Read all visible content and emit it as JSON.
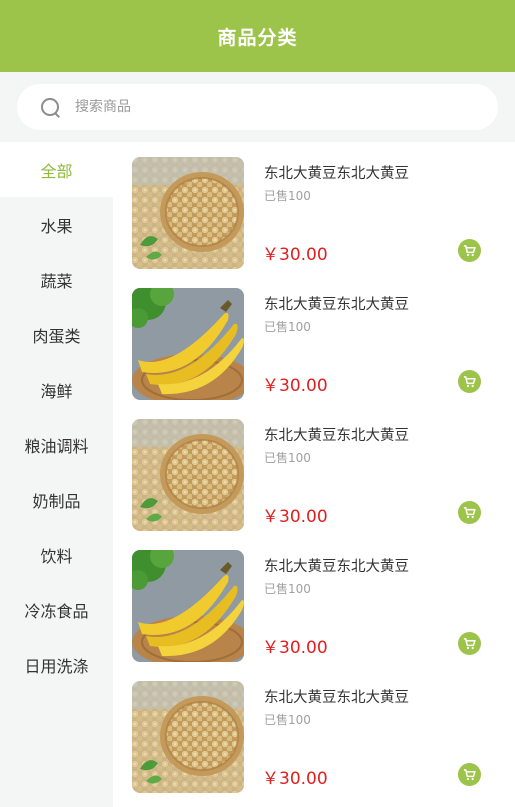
{
  "header": {
    "title": "商品分类"
  },
  "search": {
    "placeholder": "搜索商品"
  },
  "sidebar": {
    "items": [
      {
        "label": "全部",
        "active": true
      },
      {
        "label": "水果"
      },
      {
        "label": "蔬菜"
      },
      {
        "label": "肉蛋类"
      },
      {
        "label": "海鲜"
      },
      {
        "label": "粮油调料"
      },
      {
        "label": "奶制品"
      },
      {
        "label": "饮料"
      },
      {
        "label": "冷冻食品"
      },
      {
        "label": "日用洗涤"
      }
    ]
  },
  "products": [
    {
      "name": "东北大黄豆东北大黄豆",
      "sold": "已售100",
      "price": "￥30.00",
      "image": "soybeans"
    },
    {
      "name": "东北大黄豆东北大黄豆",
      "sold": "已售100",
      "price": "￥30.00",
      "image": "bananas"
    },
    {
      "name": "东北大黄豆东北大黄豆",
      "sold": "已售100",
      "price": "￥30.00",
      "image": "soybeans"
    },
    {
      "name": "东北大黄豆东北大黄豆",
      "sold": "已售100",
      "price": "￥30.00",
      "image": "bananas"
    },
    {
      "name": "东北大黄豆东北大黄豆",
      "sold": "已售100",
      "price": "￥30.00",
      "image": "soybeans"
    }
  ],
  "colors": {
    "brand": "#9cc34a",
    "active_text": "#8dbb3a",
    "price": "#e02020"
  },
  "icons": {
    "search": "search-icon",
    "cart": "cart-icon"
  }
}
